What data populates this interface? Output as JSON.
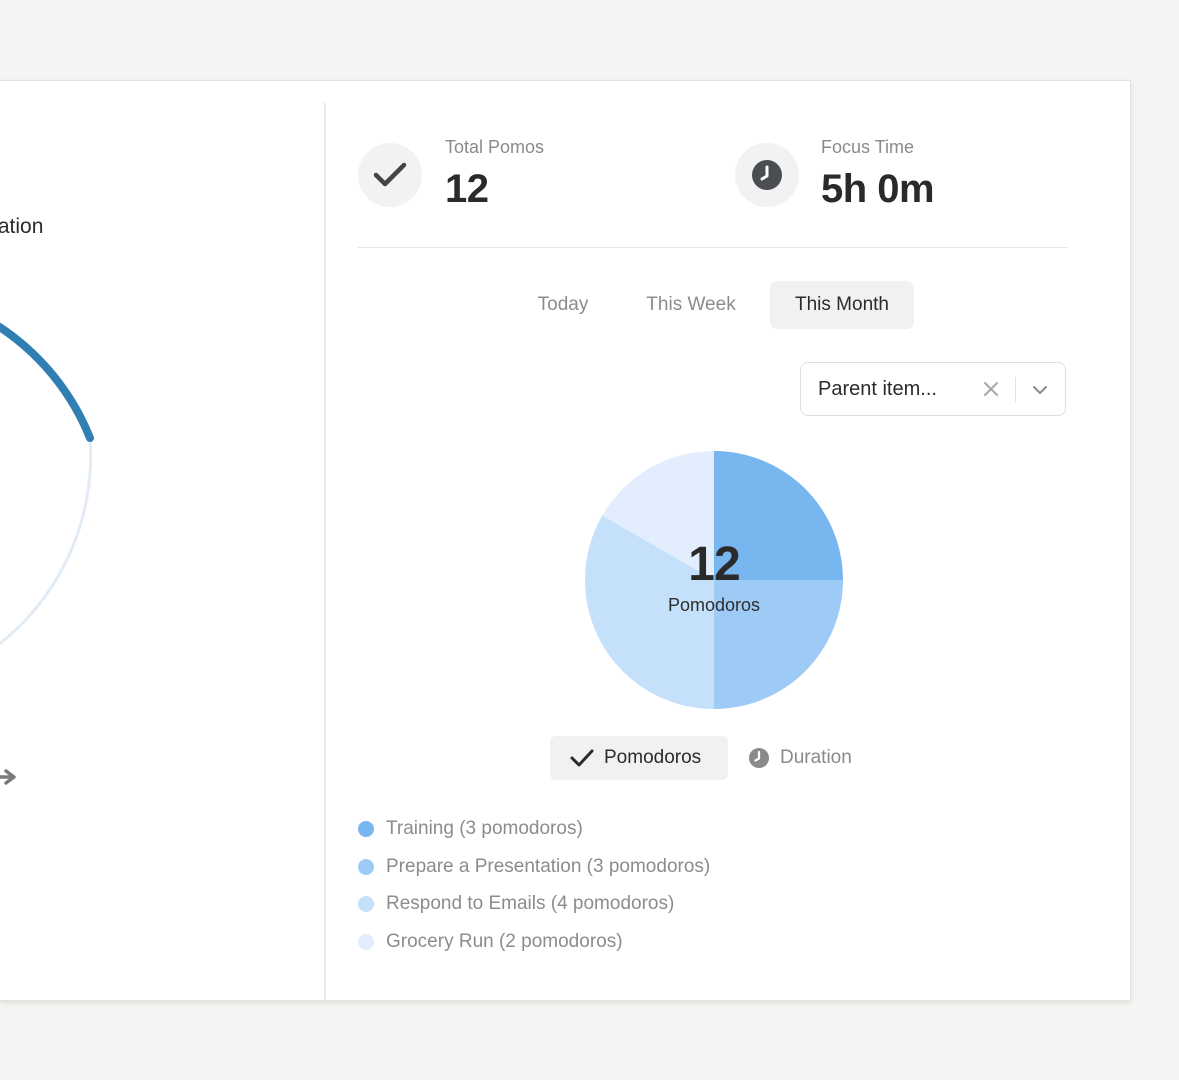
{
  "left_panel": {
    "task_name_partial": "tation"
  },
  "stats": {
    "total_pomos": {
      "label": "Total Pomos",
      "value": "12",
      "icon": "check-icon"
    },
    "focus_time": {
      "label": "Focus Time",
      "value": "5h 0m",
      "icon": "clock-icon"
    }
  },
  "period_tabs": [
    {
      "label": "Today",
      "active": false
    },
    {
      "label": "This Week",
      "active": false
    },
    {
      "label": "This Month",
      "active": true
    }
  ],
  "filter_select": {
    "value": "Parent item..."
  },
  "pie": {
    "center_value": "12",
    "center_label": "Pomodoros"
  },
  "metric_toggle": [
    {
      "label": "Pomodoros",
      "icon": "check-icon",
      "active": true
    },
    {
      "label": "Duration",
      "icon": "clock-icon",
      "active": false
    }
  ],
  "chart_data": {
    "type": "pie",
    "categories": [
      "Training",
      "Prepare a Presentation",
      "Respond to Emails",
      "Grocery Run"
    ],
    "values": [
      3,
      3,
      4,
      2
    ],
    "colors": [
      "#78b6f0",
      "#9ecbf5",
      "#c5e0fa",
      "#e2eefd"
    ],
    "legend_labels": [
      "Training (3 pomodoros)",
      "Prepare a Presentation (3 pomodoros)",
      "Respond to Emails (4 pomodoros)",
      "Grocery Run (2 pomodoros)"
    ],
    "legend_position": "bottom-left"
  },
  "colors": {
    "ring_progress": "#2f7fb2",
    "ring_track": "#e3ecf5"
  }
}
